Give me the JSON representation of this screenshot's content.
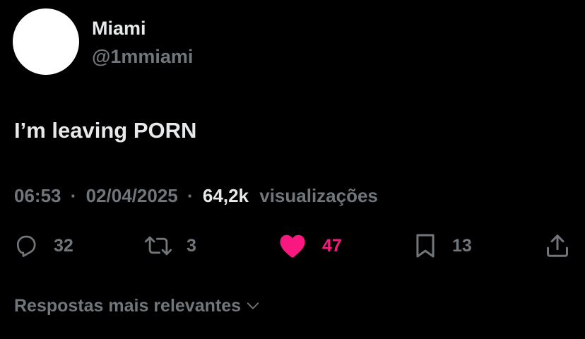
{
  "author": {
    "display_name": "Miami",
    "handle": "@1mmiami",
    "avatar_color": "#ffffff"
  },
  "tweet": {
    "text": "I’m leaving PORN"
  },
  "meta": {
    "time": "06:53",
    "separator": "·",
    "date": "02/04/2025",
    "views_count": "64,2k",
    "views_label": "visualizações"
  },
  "actions": {
    "reply": {
      "icon": "reply-icon",
      "count": "32"
    },
    "retweet": {
      "icon": "retweet-icon",
      "count": "3"
    },
    "like": {
      "icon": "heart-icon",
      "count": "47",
      "active": true,
      "color": "#f91880"
    },
    "bookmark": {
      "icon": "bookmark-icon",
      "count": "13"
    },
    "share": {
      "icon": "share-icon"
    }
  },
  "replies_sort": {
    "label": "Respostas mais relevantes",
    "icon": "chevron-down-icon"
  },
  "colors": {
    "background": "#000000",
    "primary_text": "#e7e9ea",
    "secondary_text": "#71767b",
    "like": "#f91880"
  }
}
